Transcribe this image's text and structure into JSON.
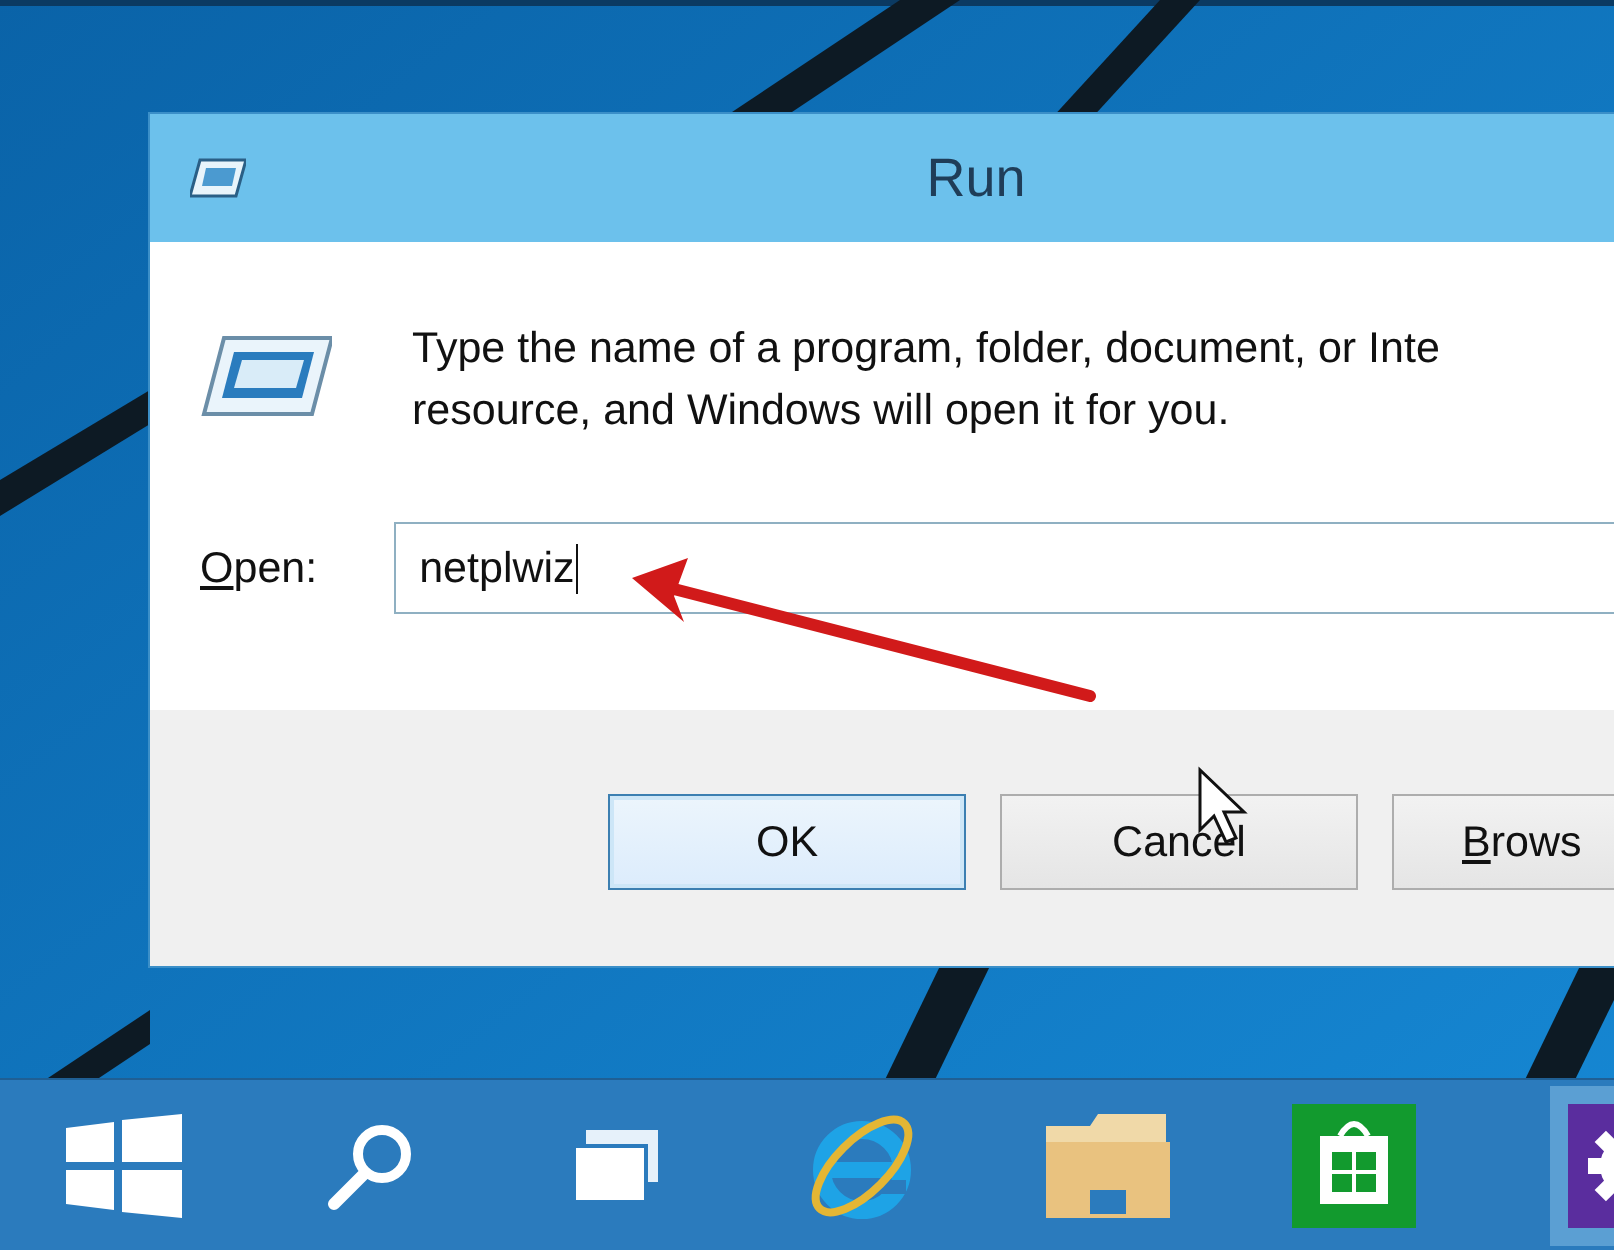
{
  "window": {
    "title": "Run"
  },
  "description": "Type the name of a program, folder, document, or Inte\nresource, and Windows will open it for you.",
  "open_field": {
    "label": "Open:",
    "value": "netplwiz"
  },
  "buttons": [
    {
      "label": "OK",
      "focused": true
    },
    {
      "label": "Cancel",
      "focused": false
    },
    {
      "label": "Brows",
      "focused": false
    }
  ],
  "taskbar": {
    "items": [
      {
        "kind": "start",
        "active": false
      },
      {
        "kind": "search",
        "active": false
      },
      {
        "kind": "task-view",
        "active": false
      },
      {
        "kind": "browser",
        "active": false
      },
      {
        "kind": "explorer",
        "active": false
      },
      {
        "kind": "store",
        "active": false
      },
      {
        "kind": "settings",
        "active": true
      }
    ]
  }
}
